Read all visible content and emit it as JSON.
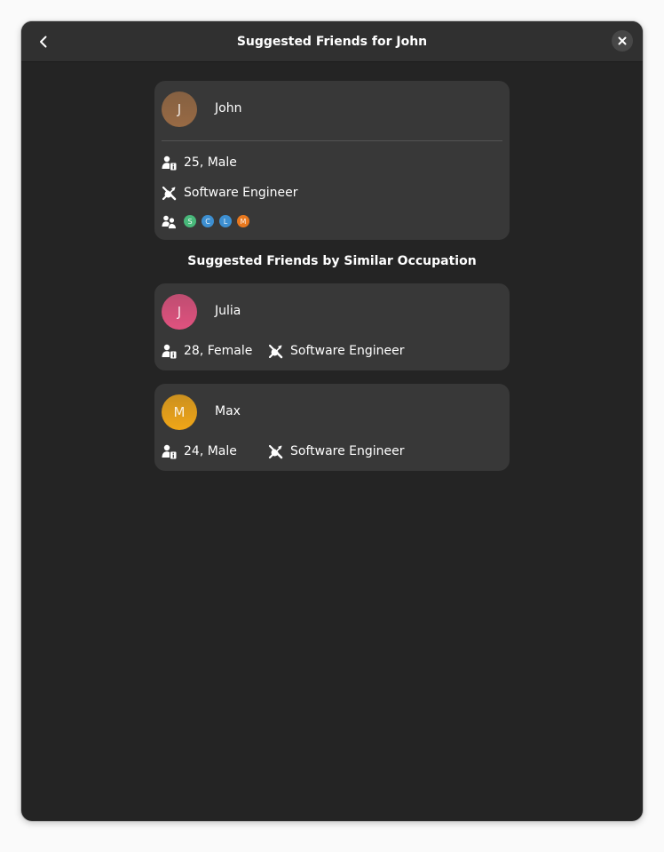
{
  "window": {
    "title": "Suggested Friends for John"
  },
  "profile": {
    "initial": "J",
    "name": "John",
    "age_gender": "25, Male",
    "occupation": "Software Engineer",
    "friend_chips": [
      {
        "letter": "S",
        "color": "#48b87a"
      },
      {
        "letter": "C",
        "color": "#3d8fd1"
      },
      {
        "letter": "L",
        "color": "#3d8fd1"
      },
      {
        "letter": "M",
        "color": "#e8781e"
      }
    ],
    "avatar_color": "#986a44"
  },
  "section": {
    "title": "Suggested Friends by Similar Occupation"
  },
  "suggestions": [
    {
      "initial": "J",
      "name": "Julia",
      "age_gender": "28, Female",
      "occupation": "Software Engineer",
      "avatar_color": "#e0527f"
    },
    {
      "initial": "M",
      "name": "Max",
      "age_gender": "24, Male",
      "occupation": "Software Engineer",
      "avatar_color": "#f0a618"
    }
  ],
  "icons": {
    "back": "go-previous-icon",
    "close": "window-close-icon",
    "person_info": "person-info-icon",
    "tools": "tools-icon",
    "people": "people-icon"
  }
}
